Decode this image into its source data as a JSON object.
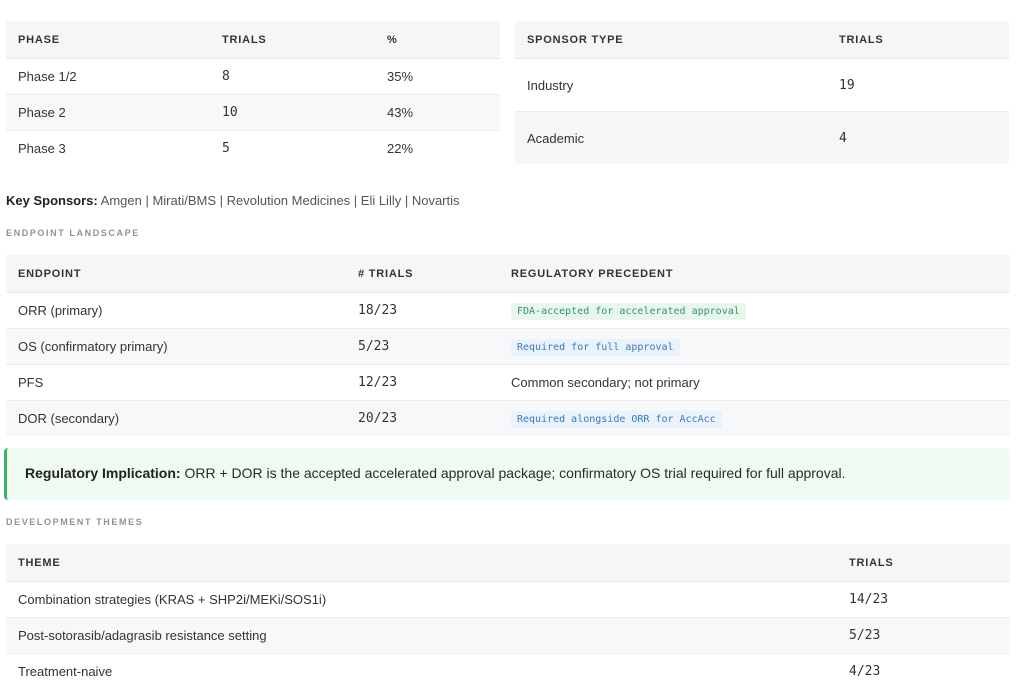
{
  "phase_table": {
    "headers": [
      "PHASE",
      "TRIALS",
      "%"
    ],
    "rows": [
      [
        "Phase 1/2",
        "8",
        "35%"
      ],
      [
        "Phase 2",
        "10",
        "43%"
      ],
      [
        "Phase 3",
        "5",
        "22%"
      ]
    ]
  },
  "sponsor_table": {
    "headers": [
      "SPONSOR TYPE",
      "TRIALS"
    ],
    "rows": [
      [
        "Industry",
        "19"
      ],
      [
        "Academic",
        "4"
      ]
    ]
  },
  "key_sponsors": {
    "label": "Key Sponsors:",
    "text": "Amgen | Mirati/BMS | Revolution Medicines | Eli Lilly | Novartis"
  },
  "endpoint_section": {
    "label": "ENDPOINT LANDSCAPE",
    "headers": [
      "ENDPOINT",
      "# TRIALS",
      "REGULATORY PRECEDENT"
    ],
    "rows": [
      {
        "endpoint": "ORR (primary)",
        "trials": "18/23",
        "precedent": "FDA-accepted for accelerated approval",
        "style": "green"
      },
      {
        "endpoint": "OS (confirmatory primary)",
        "trials": "5/23",
        "precedent": "Required for full approval",
        "style": "blue"
      },
      {
        "endpoint": "PFS",
        "trials": "12/23",
        "precedent": "Common secondary; not primary",
        "style": "plain"
      },
      {
        "endpoint": "DOR (secondary)",
        "trials": "20/23",
        "precedent": "Required alongside ORR for AccAcc",
        "style": "blue"
      }
    ]
  },
  "callout": {
    "label": "Regulatory Implication:",
    "text": " ORR + DOR is the accepted accelerated approval package; confirmatory OS trial required for full approval."
  },
  "themes_section": {
    "label": "DEVELOPMENT THEMES",
    "headers": [
      "THEME",
      "TRIALS"
    ],
    "rows": [
      [
        "Combination strategies (KRAS + SHP2i/MEKi/SOS1i)",
        "14/23"
      ],
      [
        "Post-sotorasib/adagrasib resistance setting",
        "5/23"
      ],
      [
        "Treatment-naive",
        "4/23"
      ]
    ]
  },
  "colors": {
    "accent_green": "#37b26a",
    "pill_green_text": "#2f9a5c",
    "pill_blue_text": "#3d78c2"
  }
}
